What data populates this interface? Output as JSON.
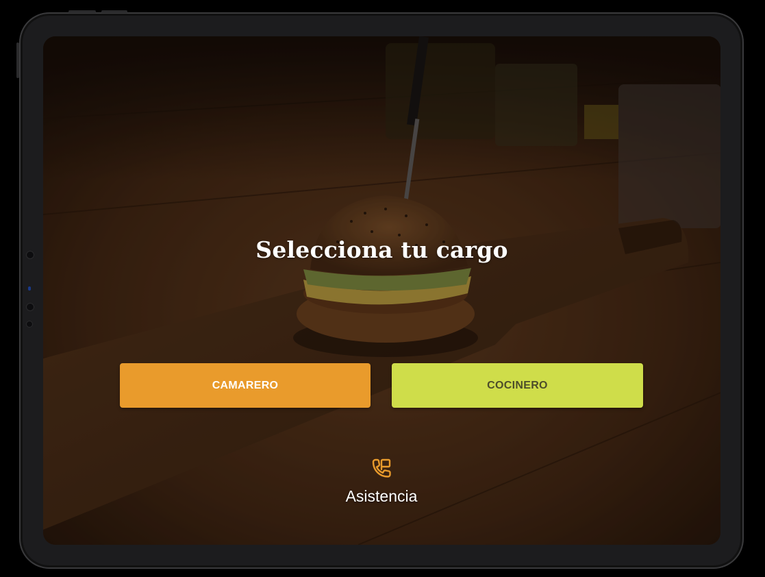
{
  "screen": {
    "title": "Selecciona tu cargo",
    "background": "burger-on-wooden-board-photo"
  },
  "roles": [
    {
      "label": "CAMARERO",
      "color": "#e99b2c"
    },
    {
      "label": "COCINERO",
      "color": "#cfdd4a"
    }
  ],
  "assistance": {
    "label": "Asistencia",
    "icon": "phone-assistance-icon",
    "color": "#e99b2c"
  }
}
